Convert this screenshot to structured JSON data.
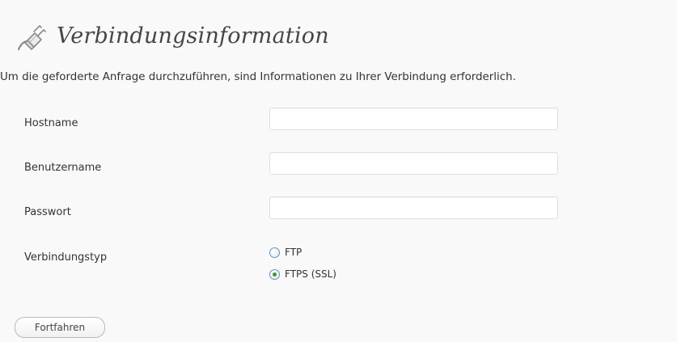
{
  "header": {
    "title": "Verbindungsinformation",
    "icon": "plug-icon"
  },
  "intro": {
    "text": "Um die geforderte Anfrage durchzuführen, sind Informationen zu Ihrer Verbindung erforderlich."
  },
  "form": {
    "hostname": {
      "label": "Hostname",
      "value": ""
    },
    "username": {
      "label": "Benutzername",
      "value": ""
    },
    "password": {
      "label": "Passwort",
      "value": ""
    },
    "connection_type": {
      "label": "Verbindungstyp",
      "options": [
        {
          "label": "FTP",
          "checked": false
        },
        {
          "label": "FTPS (SSL)",
          "checked": true
        }
      ]
    },
    "submit_label": "Fortfahren"
  },
  "colors": {
    "background": "#f9f9f9",
    "radio_border": "#6a8fb8",
    "radio_checked_dot": "#3b9a2b"
  }
}
